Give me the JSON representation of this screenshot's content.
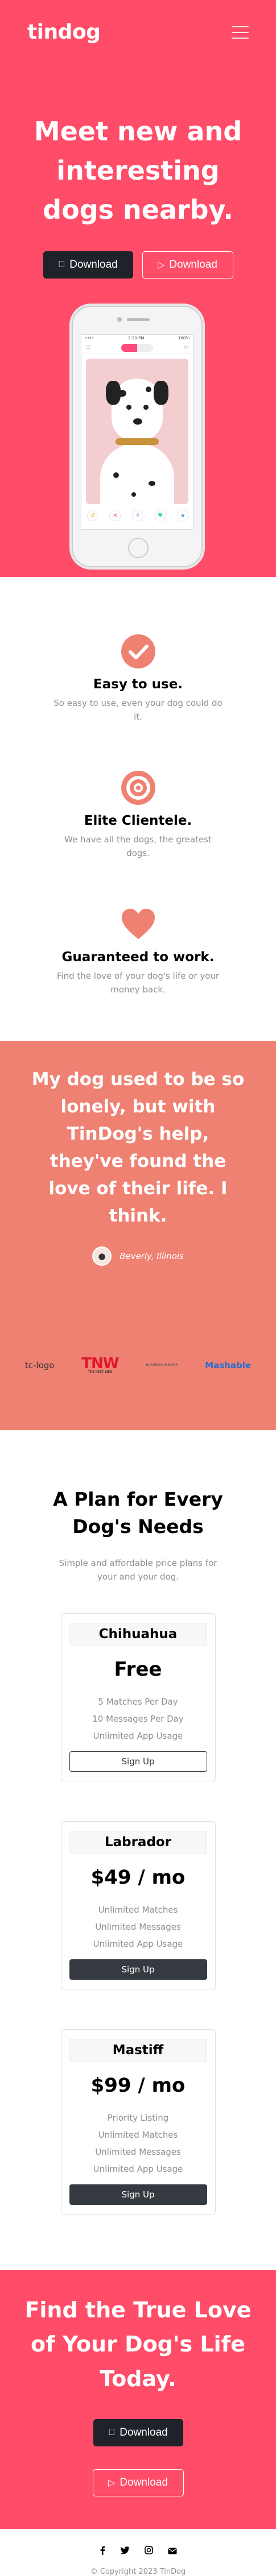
{
  "navbar": {
    "brand": "tindog"
  },
  "hero": {
    "title": "Meet new and interesting dogs nearby.",
    "download_apple_label": "Download",
    "download_google_label": "Download"
  },
  "phone_status": {
    "carrier": "••••",
    "time": "2:20 PM",
    "battery": "100%"
  },
  "features": [
    {
      "title": "Easy to use.",
      "text": "So easy to use, even your dog could do it."
    },
    {
      "title": "Elite Clientele.",
      "text": "We have all the dogs, the greatest dogs."
    },
    {
      "title": "Guaranteed to work.",
      "text": "Find the love of your dog's life or your money back."
    }
  ],
  "testimonial": {
    "quote": "My dog used to be so lonely, but with TinDog's help, they've found the love of their life. I think.",
    "author": "Beverly, Illinois"
  },
  "press_logos": [
    {
      "name": "tc-logo",
      "text": "tc-logo"
    },
    {
      "name": "tnw",
      "text": "TNW",
      "sub": "THE NEXT WEB"
    },
    {
      "name": "business-insider",
      "text": "BUSINESS INSIDER"
    },
    {
      "name": "mashable",
      "text": "Mashable"
    }
  ],
  "pricing": {
    "title": "A Plan for Every Dog's Needs",
    "subtitle": "Simple and affordable price plans for your and your dog.",
    "plans": [
      {
        "name": "Chihuahua",
        "price": "Free",
        "features": [
          "5 Matches Per Day",
          "10 Messages Per Day",
          "Unlimited App Usage"
        ],
        "button": "Sign Up"
      },
      {
        "name": "Labrador",
        "price": "$49 / mo",
        "features": [
          "Unlimited Matches",
          "Unlimited Messages",
          "Unlimited App Usage"
        ],
        "button": "Sign Up"
      },
      {
        "name": "Mastiff",
        "price": "$99 / mo",
        "features": [
          "Priority Listing",
          "Unlimited Matches",
          "Unlimited Messages",
          "Unlimited App Usage"
        ],
        "button": "Sign Up"
      }
    ]
  },
  "cta": {
    "title": "Find the True Love of Your Dog's Life Today.",
    "download_apple_label": "Download",
    "download_google_label": "Download"
  },
  "footer": {
    "copyright": "© Copyright 2023 TinDog"
  },
  "colors": {
    "brand_red": "#ff4c68",
    "testimonial_bg": "#ef8172",
    "dark": "#343a40"
  },
  "icons": [
    "hamburger-icon",
    "apple-icon",
    "play-icon",
    "check-circle-icon",
    "bullseye-icon",
    "heart-icon",
    "facebook-icon",
    "twitter-icon",
    "instagram-icon",
    "envelope-icon"
  ]
}
